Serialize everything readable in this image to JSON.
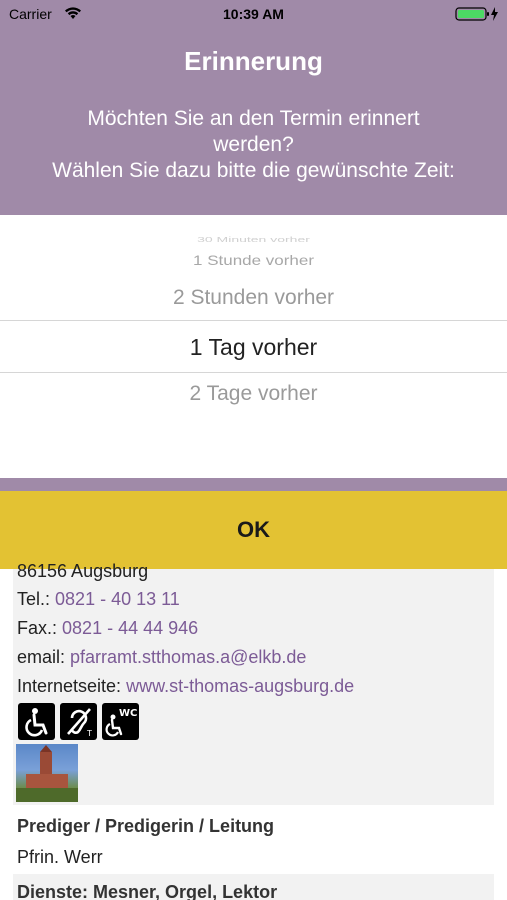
{
  "status_bar": {
    "carrier": "Carrier",
    "time": "10:39 AM",
    "wifi_icon": "wifi-icon",
    "battery_icon": "battery-charging-icon"
  },
  "dialog": {
    "title": "Erinnerung",
    "message_line1": "Möchten Sie an den Termin erinnert",
    "message_line2": "werden?",
    "message_line3": "Wählen Sie dazu bitte die gewünschte Zeit:",
    "picker": {
      "options": [
        "30 Minuten vorher",
        "1 Stunde vorher",
        "2 Stunden vorher",
        "1 Tag vorher",
        "2 Tage vorher"
      ],
      "selected": "1 Tag vorher"
    },
    "ok_label": "OK"
  },
  "contact": {
    "address_partial": "86156 Augsburg",
    "tel_label": "Tel.:",
    "tel_value": "0821 - 40 13 11",
    "fax_label": "Fax.:",
    "fax_value": "0821 - 44 44 946",
    "email_label": "email:",
    "email_value": "pfarramt.stthomas.a@elkb.de",
    "web_label": "Internetseite:",
    "web_value": "www.st-thomas-augsburg.de",
    "icons": [
      "wheelchair-icon",
      "hearing-loop-icon",
      "accessible-wc-icon"
    ],
    "wc_text": "WC",
    "photo": "church-photo"
  },
  "leitung": {
    "heading": "Prediger / Predigerin / Leitung",
    "value": "Pfrin. Werr"
  },
  "dienste": {
    "heading": "Dienste: Mesner, Orgel, Lektor"
  },
  "colors": {
    "header_purple": "#a08aa8",
    "ok_yellow": "#e3c233",
    "link_purple": "#7c5b96"
  }
}
